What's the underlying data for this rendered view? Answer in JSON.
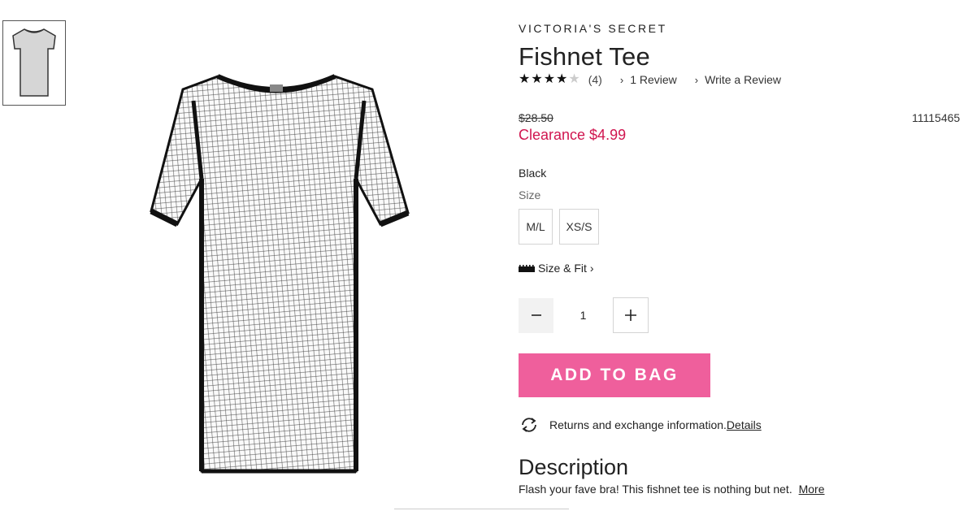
{
  "product": {
    "brand": "VICTORIA'S SECRET",
    "title": "Fishnet Tee",
    "rating": 4,
    "rating_max": 5,
    "rating_count": "(4)",
    "review_link": "1 Review",
    "write_review_link": "Write a Review",
    "original_price": "$28.50",
    "sale_price": "Clearance $4.99",
    "sku": "11115465",
    "color": "Black",
    "size_label": "Size",
    "sizes": [
      "M/L",
      "XS/S"
    ],
    "size_fit_label": "Size & Fit",
    "quantity": "1",
    "add_to_bag": "ADD TO BAG",
    "returns_text": "Returns and exchange information.",
    "returns_link": "Details",
    "description_title": "Description",
    "description_text": "Flash your fave bra! This fishnet tee is nothing but net.",
    "description_more": "More"
  },
  "colors": {
    "sale": "#d0154f",
    "button": "#ef5f9c"
  }
}
